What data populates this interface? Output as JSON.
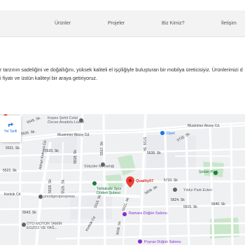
{
  "nav": {
    "items": [
      "Ürünler",
      "Projeler",
      "Biz Kimiz?",
      "İletişim"
    ]
  },
  "intro": {
    "line1": "r tarzının sadeliğini ve doğallığını, yüksek kaliteli el işçiliğiyle buluşturan bir mobilya üreticisiyiz. Ürünlerimizi d",
    "line2": "i fiyatı ve üstün kaliteyi bir araya getiriyoruz."
  },
  "map": {
    "directions_label": "Yol Tarifi",
    "marker_label": "Quality07",
    "pois": {
      "school": "Kepez Şehit Celal\nÖzcan Anadolu Lisesi",
      "cemetery": "Sütçüler Mezarlığı",
      "sport": "Tahtakale Spor\nDüden Şubesi",
      "opet": "Opet",
      "park": "Şelale Park",
      "evleri": "Yıldız Park Evleri",
      "ramara": "Ramara Düğün Salonu",
      "prestige": "prestigevipexpress",
      "oto": "OTO MOTOR TAMİR\nEGZOZ VE YAĞ...",
      "poyraz": "Poyraz Düğün Salonu"
    },
    "roads": {
      "muammer1": "Muammer Aksoy Cd.",
      "muammer2": "Muammer Aksoy Cd.",
      "kerkuk": "Kerkük Cd",
      "kerkuk2": "Kerkük Cd",
      "adnan": "Adnan Kahveci Cd.",
      "s5545": "5545. Sk.",
      "s5535": "5535. Sk.",
      "s5531": "5531. Sk.",
      "s5518": "5518. Sk",
      "s5522": "5522. Sk",
      "s5517": "5517. Sk",
      "s5638": "5638. Sk",
      "s5710": "5710. Sk",
      "s5640": "5640. Sk",
      "s5624": "5624. Sk",
      "s5526": "5526. Sk.",
      "s5516": "5516. Sk",
      "s5621": "5621. Sk",
      "s5636": "5636. Sk",
      "s5732": "5732. Sk.",
      "s5520": "5520. Sk",
      "s5528": "5528. Sk",
      "s5609": "5609. Sk",
      "s5615": "5615. Sk",
      "s5716": "5716. Sk",
      "s5543": "5543. Sk"
    }
  },
  "colors": {
    "navbar_bg": "#f3f3f3",
    "map_bg": "#eef0f2",
    "road": "#ffffff",
    "major_road": "#ffffff",
    "park": "#c8e6c9",
    "marker": "#ea4335",
    "link_blue": "#1a73e8"
  }
}
